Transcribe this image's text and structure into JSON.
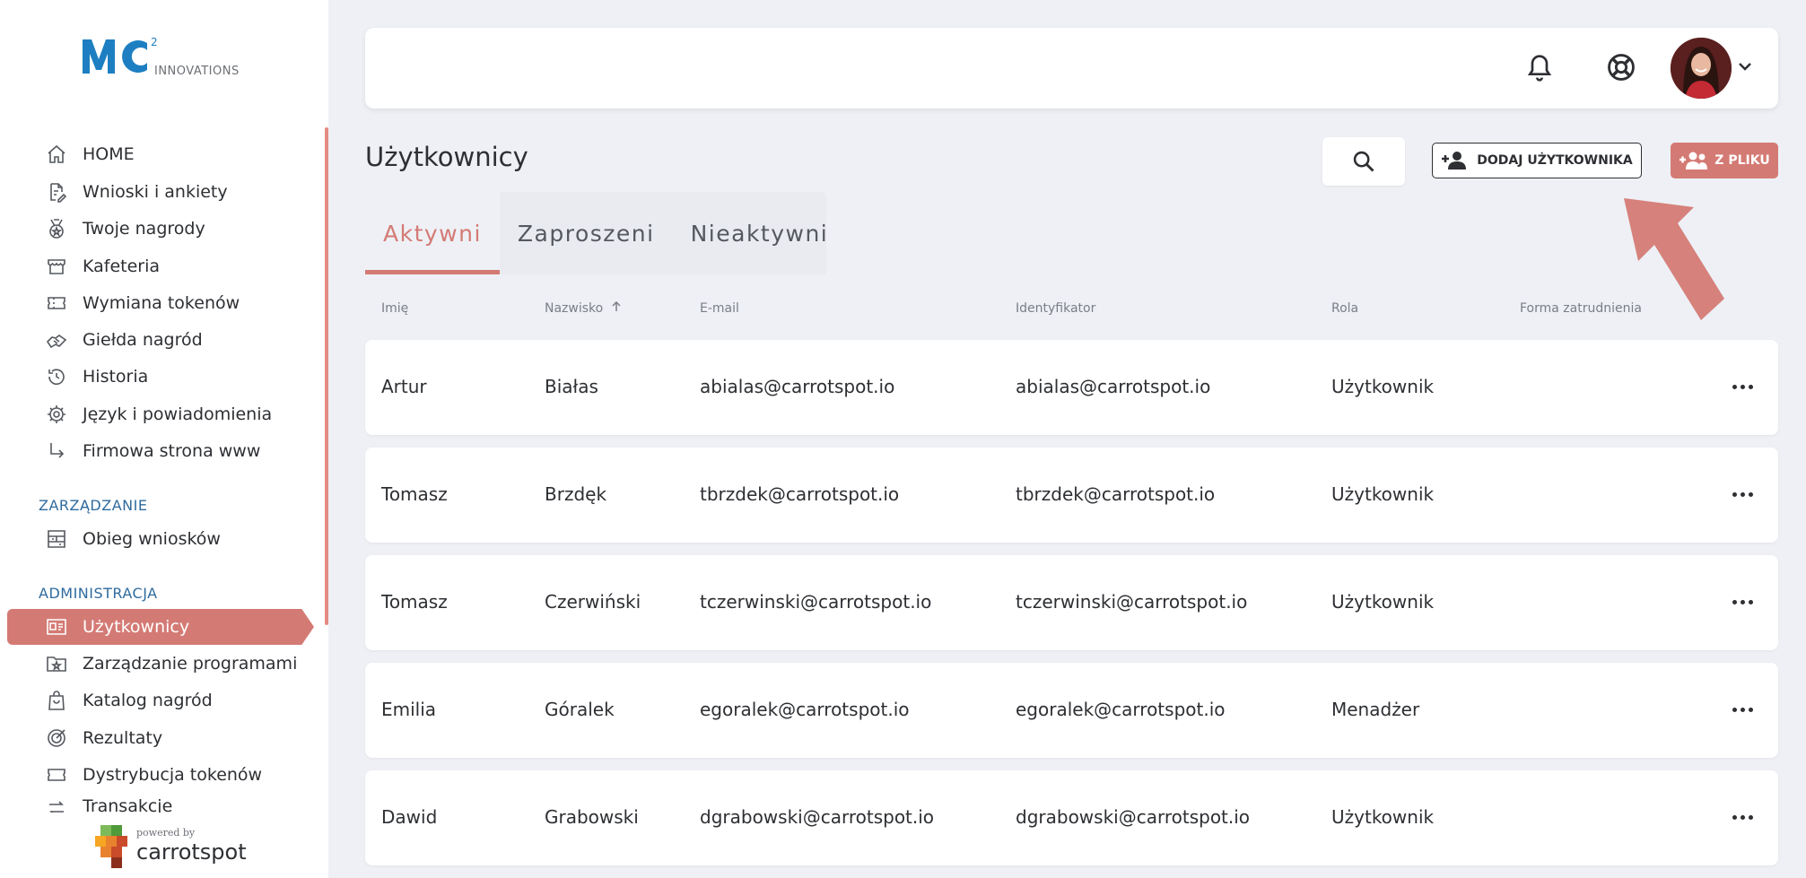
{
  "brand": {
    "logo_sup": "2",
    "logo_text": "INNOVATIONS",
    "powered_by": "powered by",
    "powered_name": "carrotspot"
  },
  "sidebar": {
    "main_items": [
      {
        "label": "HOME",
        "icon": "home-icon"
      },
      {
        "label": "Wnioski i ankiety",
        "icon": "document-edit-icon"
      },
      {
        "label": "Twoje nagrody",
        "icon": "medal-icon"
      },
      {
        "label": "Kafeteria",
        "icon": "store-icon"
      },
      {
        "label": "Wymiana tokenów",
        "icon": "ticket-icon"
      },
      {
        "label": "Giełda nagród",
        "icon": "handshake-icon"
      },
      {
        "label": "Historia",
        "icon": "history-icon"
      },
      {
        "label": "Język i powiadomienia",
        "icon": "gear-icon"
      },
      {
        "label": "Firmowa strona www",
        "icon": "arrow-turn-icon"
      }
    ],
    "section_management": "ZARZĄDZANIE",
    "management_items": [
      {
        "label": "Obieg wniosków",
        "icon": "workflow-icon"
      }
    ],
    "section_admin": "ADMINISTRACJA",
    "admin_items": [
      {
        "label": "Użytkownicy",
        "icon": "id-card-icon",
        "active": true
      },
      {
        "label": "Zarządzanie programami",
        "icon": "folder-star-icon"
      },
      {
        "label": "Katalog nagród",
        "icon": "bag-icon"
      },
      {
        "label": "Rezultaty",
        "icon": "target-icon"
      },
      {
        "label": "Dystrybucja tokenów",
        "icon": "ticket-icon"
      },
      {
        "label": "Transakcje",
        "icon": "transfer-icon"
      }
    ]
  },
  "header": {
    "bell_icon": "bell-icon",
    "help_icon": "lifebuoy-icon",
    "avatar": "user-avatar"
  },
  "page": {
    "title": "Użytkownicy",
    "add_user_label": "DODAJ UŻYTKOWNIKA",
    "from_file_label": "Z PLIKU"
  },
  "tabs": [
    {
      "label": "Aktywni",
      "active": true
    },
    {
      "label": "Zaproszeni",
      "active": false
    },
    {
      "label": "Nieaktywni",
      "active": false
    }
  ],
  "table": {
    "columns": [
      "Imię",
      "Nazwisko",
      "E-mail",
      "Identyfikator",
      "Rola",
      "Forma zatrudnienia"
    ],
    "sorted_column": "Nazwisko",
    "sort_direction": "asc",
    "rows": [
      {
        "first": "Artur",
        "last": "Białas",
        "email": "abialas@carrotspot.io",
        "id": "abialas@carrotspot.io",
        "role": "Użytkownik",
        "employment": ""
      },
      {
        "first": "Tomasz",
        "last": "Brzdęk",
        "email": "tbrzdek@carrotspot.io",
        "id": "tbrzdek@carrotspot.io",
        "role": "Użytkownik",
        "employment": ""
      },
      {
        "first": "Tomasz",
        "last": "Czerwiński",
        "email": "tczerwinski@carrotspot.io",
        "id": "tczerwinski@carrotspot.io",
        "role": "Użytkownik",
        "employment": ""
      },
      {
        "first": "Emilia",
        "last": "Góralek",
        "email": "egoralek@carrotspot.io",
        "id": "egoralek@carrotspot.io",
        "role": "Menadżer",
        "employment": ""
      },
      {
        "first": "Dawid",
        "last": "Grabowski",
        "email": "dgrabowski@carrotspot.io",
        "id": "dgrabowski@carrotspot.io",
        "role": "Użytkownik",
        "employment": ""
      }
    ]
  },
  "colors": {
    "accent": "#d47a74",
    "brand_blue": "#1d7fc2",
    "background": "#eef0f5"
  }
}
